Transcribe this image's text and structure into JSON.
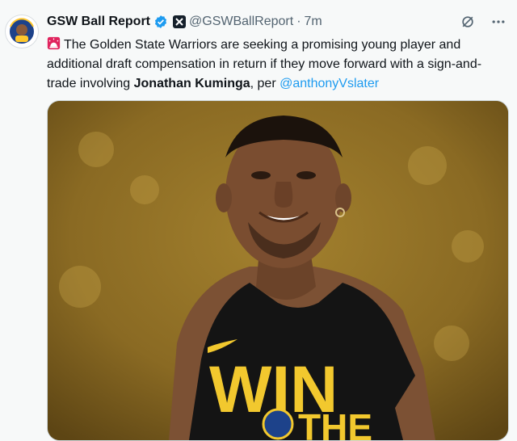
{
  "account": {
    "display_name": "GSW Ball Report",
    "handle": "@GSWBallReport",
    "separator": "·",
    "time": "7m",
    "avatar_text": "GSW BALL REPORT"
  },
  "tweet": {
    "text_part1": "The Golden State Warriors are seeking a promising young player and additional draft compensation in return if they move forward with a sign-and-trade involving ",
    "bold_name": "Jonathan Kuminga",
    "text_part2": ", per ",
    "mention": "@anthonyVslater"
  },
  "media": {
    "shirt_text_line1": "WIN",
    "shirt_text_line2": "THE"
  },
  "colors": {
    "accent": "#1d9bf0",
    "muted": "#536471",
    "background": "#f7f9f9"
  },
  "icons": [
    "siren-emoji",
    "verified-badge",
    "x-badge",
    "grok-icon",
    "more-icon"
  ]
}
